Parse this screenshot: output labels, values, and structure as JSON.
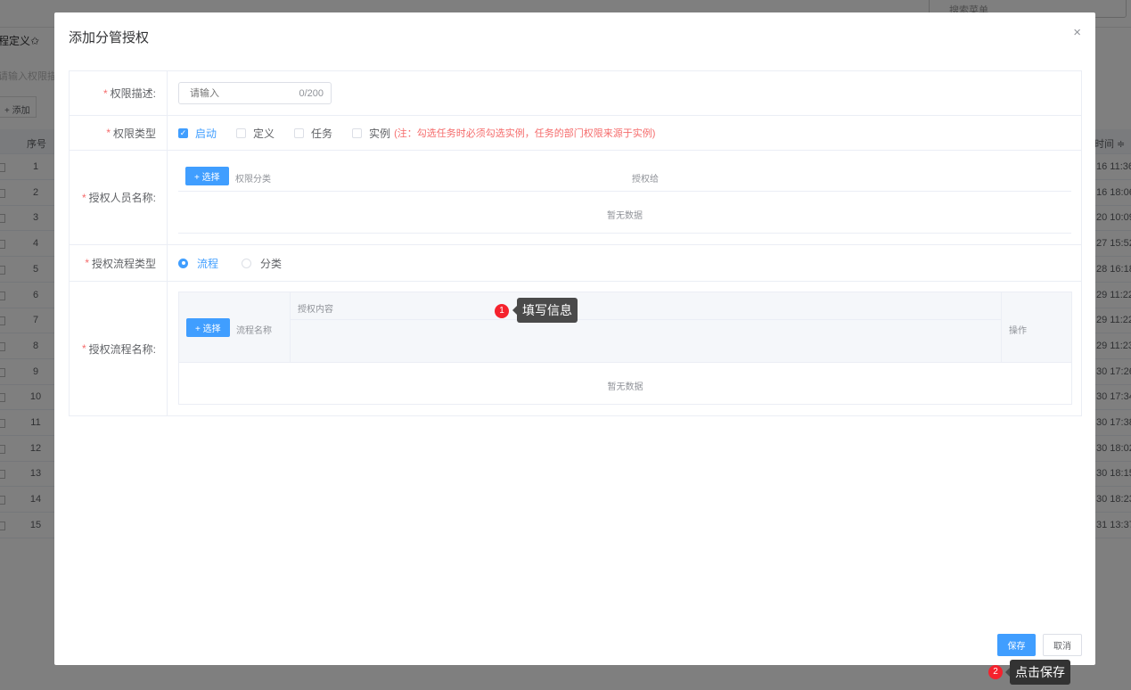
{
  "background": {
    "search_placeholder": "搜索菜单",
    "tab_title": "程定义✩",
    "filter_placeholder": "请输入权限描述",
    "add_label": "添加",
    "col_index": "序号",
    "col_time": "时间 ≑",
    "rows": [
      {
        "num": "1",
        "time": "16 11:36"
      },
      {
        "num": "2",
        "time": "16 18:06"
      },
      {
        "num": "3",
        "time": "20 10:09"
      },
      {
        "num": "4",
        "time": "27 15:52"
      },
      {
        "num": "5",
        "time": "28 16:18"
      },
      {
        "num": "6",
        "time": "29 11:22"
      },
      {
        "num": "7",
        "time": "29 11:22"
      },
      {
        "num": "8",
        "time": "29 11:23"
      },
      {
        "num": "9",
        "time": "30 17:26"
      },
      {
        "num": "10",
        "time": "30 17:34"
      },
      {
        "num": "11",
        "time": "30 17:38"
      },
      {
        "num": "12",
        "time": "30 18:02"
      },
      {
        "num": "13",
        "time": "30 18:15"
      },
      {
        "num": "14",
        "time": "30 18:23"
      },
      {
        "num": "15",
        "time": "31 13:37"
      }
    ]
  },
  "modal": {
    "title": "添加分管授权",
    "close": "×",
    "fields": {
      "desc_label": "权限描述:",
      "desc_placeholder": "请输入",
      "desc_value": "",
      "desc_count": "0/200",
      "type_label": "权限类型",
      "type_options": [
        {
          "label": "启动",
          "checked": true
        },
        {
          "label": "定义",
          "checked": false
        },
        {
          "label": "任务",
          "checked": false
        },
        {
          "label": "实例",
          "checked": false
        }
      ],
      "type_note": "(注：勾选任务时必须勾选实例，任务的部门权限来源于实例)",
      "person_label": "授权人员名称:",
      "select_label": "+ 选择",
      "person_col_category": "权限分类",
      "person_col_grant": "授权给",
      "empty_text": "暂无数据",
      "flow_type_label": "授权流程类型",
      "flow_type_options": [
        {
          "label": "流程",
          "selected": true
        },
        {
          "label": "分类",
          "selected": false
        }
      ],
      "flow_name_label": "授权流程名称:",
      "flow_col_name": "流程名称",
      "flow_col_content": "授权内容",
      "flow_col_action": "操作"
    },
    "save": "保存",
    "cancel": "取消"
  },
  "guides": [
    {
      "step": "1",
      "text": "填写信息"
    },
    {
      "step": "2",
      "text": "点击保存"
    }
  ],
  "colors": {
    "primary": "#409eff",
    "required": "#f56c6c",
    "badge": "#f5222d"
  }
}
